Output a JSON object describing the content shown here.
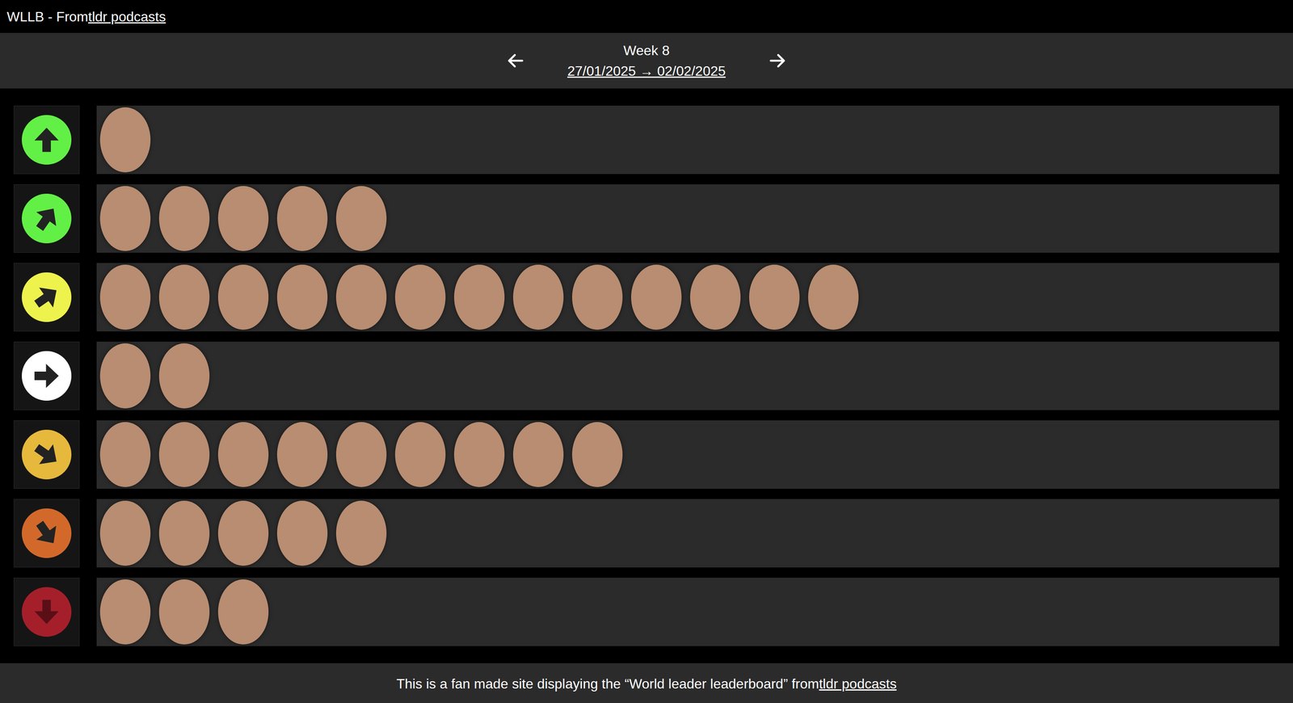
{
  "header": {
    "title": "WLLB - From ",
    "link": "tldr podcasts"
  },
  "nav": {
    "week": "Week 8",
    "range": "27/01/2025 → 02/02/2025"
  },
  "tiers": [
    {
      "direction": "up",
      "color": "#63f046",
      "portrait_count": 1
    },
    {
      "direction": "up-right-steep",
      "color": "#63f046",
      "portrait_count": 5
    },
    {
      "direction": "up-right",
      "color": "#eef24c",
      "portrait_count": 13
    },
    {
      "direction": "right",
      "color": "#ffffff",
      "portrait_count": 2
    },
    {
      "direction": "down-right",
      "color": "#e6b93d",
      "portrait_count": 9
    },
    {
      "direction": "down-right-steep",
      "color": "#d2692b",
      "portrait_count": 5
    },
    {
      "direction": "down",
      "color": "#a51f2b",
      "portrait_count": 3
    }
  ],
  "footer": {
    "text": "This is a fan made site displaying the “World leader leaderboard” from ",
    "link": "tldr podcasts"
  }
}
